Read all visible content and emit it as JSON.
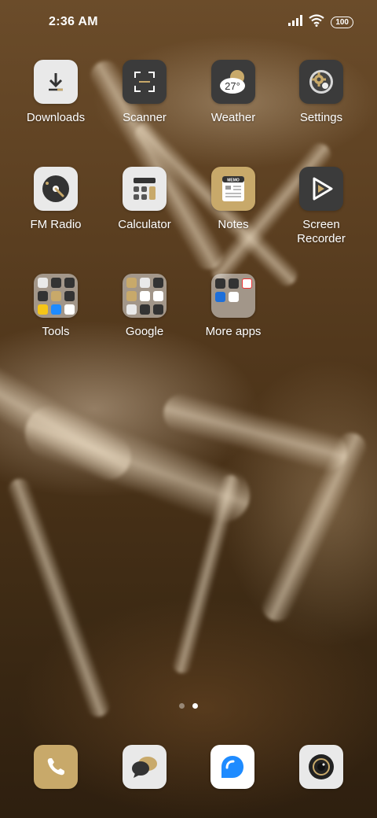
{
  "status_bar": {
    "time": "2:36 AM",
    "signal_icon": "cellular-signal-icon",
    "wifi_icon": "wifi-icon",
    "battery_level": "100"
  },
  "apps": {
    "downloads": {
      "label": "Downloads",
      "icon": "download-icon"
    },
    "scanner": {
      "label": "Scanner",
      "icon": "scan-frame-icon"
    },
    "weather": {
      "label": "Weather",
      "icon": "weather-cloud-icon",
      "temperature": "27°"
    },
    "settings": {
      "label": "Settings",
      "icon": "gear-icon"
    },
    "fm_radio": {
      "label": "FM Radio",
      "icon": "radio-dial-icon"
    },
    "calculator": {
      "label": "Calculator",
      "icon": "calculator-icon"
    },
    "notes": {
      "label": "Notes",
      "icon": "notepad-icon",
      "badge_text": "MEMO"
    },
    "screen_recorder": {
      "label": "Screen\nRecorder",
      "icon": "play-record-icon"
    }
  },
  "folders": {
    "tools": {
      "label": "Tools"
    },
    "google": {
      "label": "Google"
    },
    "more_apps": {
      "label": "More apps"
    }
  },
  "pages": {
    "count": 2,
    "active": 2
  },
  "dock": [
    {
      "name": "phone",
      "icon": "phone-icon"
    },
    {
      "name": "messages",
      "icon": "chat-bubbles-icon"
    },
    {
      "name": "browser",
      "icon": "browser-bubble-icon"
    },
    {
      "name": "camera",
      "icon": "camera-lens-icon"
    }
  ],
  "colors": {
    "accent_gold": "#c8a96a",
    "dark_icon": "#3b3b3b",
    "light_icon": "#e9e9e9",
    "browser_blue": "#1e8bff"
  }
}
